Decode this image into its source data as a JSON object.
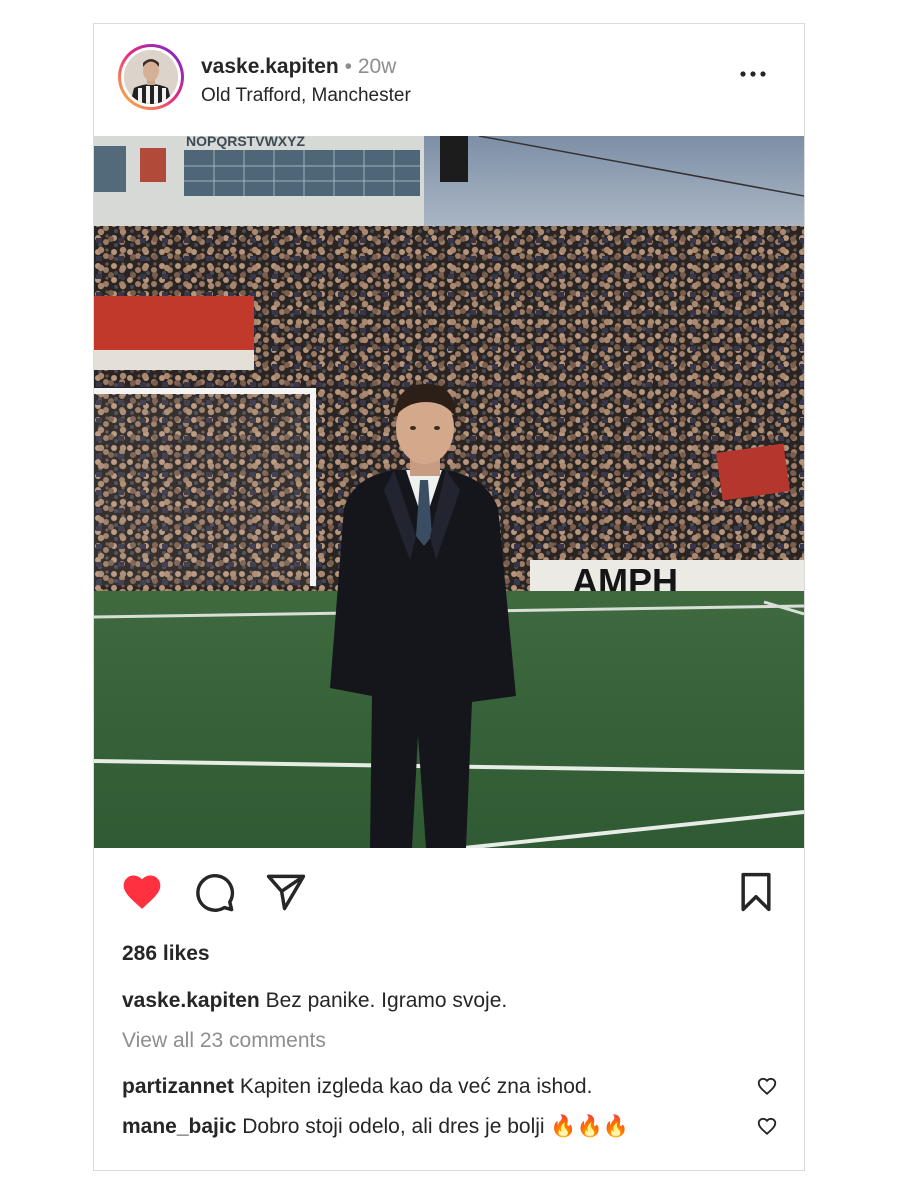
{
  "post": {
    "username": "vaske.kapiten",
    "separator": "•",
    "time_ago": "20w",
    "location": "Old Trafford, Manchester",
    "liked": true,
    "likes_text": "286 likes",
    "caption_user": "vaske.kapiten",
    "caption_text": "Bez panike. Igramo svoje.",
    "view_comments": "View all 23 comments"
  },
  "comments": [
    {
      "user": "partizannet",
      "text": "Kapiten izgleda kao da već zna ishod."
    },
    {
      "user": "mane_bajic",
      "text": "Dobro stoji odelo, ali dres je bolji 🔥🔥🔥"
    }
  ],
  "icons": {
    "like": "heart-filled-icon",
    "comment": "comment-bubble-icon",
    "share": "paper-plane-icon",
    "save": "bookmark-icon",
    "more": "more-dots-icon",
    "comment_like": "heart-outline-icon"
  },
  "colors": {
    "like_red": "#ff3040",
    "muted_text": "#8e8e8e",
    "primary_text": "#262626"
  },
  "photo": {
    "banner_text": "AMPH",
    "scoreboard_text": "NOPQRSTVWXYZ"
  }
}
